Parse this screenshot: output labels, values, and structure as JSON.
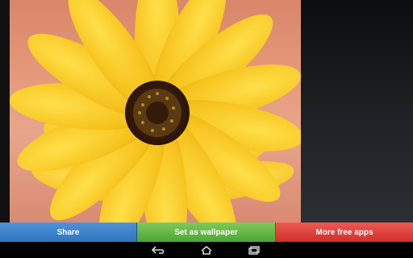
{
  "wallpaper": {
    "subject": "yellow sunflower"
  },
  "actions": {
    "share_label": "Share",
    "set_wallpaper_label": "Set as wallpaper",
    "more_apps_label": "More free apps"
  },
  "colors": {
    "share": "#3a83cc",
    "set_wallpaper": "#5bb33d",
    "more_apps": "#dd3f39"
  },
  "navbar": {
    "back_icon": "back-icon",
    "home_icon": "home-icon",
    "recents_icon": "recent-apps-icon"
  }
}
